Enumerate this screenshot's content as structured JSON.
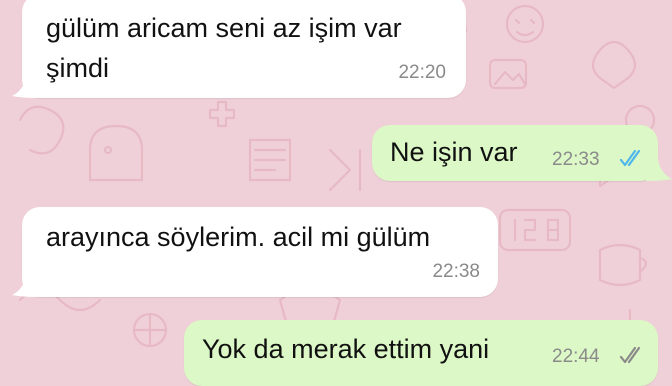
{
  "chat": {
    "wallpaper_color": "#f0d0d8",
    "incoming_bubble_color": "#ffffff",
    "outgoing_bubble_color": "#dcf8c6",
    "read_tick_color": "#4fb6ec",
    "delivered_tick_color": "#8a8a8a",
    "messages": [
      {
        "direction": "incoming",
        "text": "gülüm aricam seni az işim var\nşimdi",
        "time": "22:20"
      },
      {
        "direction": "outgoing",
        "text": "Ne işin var",
        "time": "22:33",
        "status": "read",
        "status_icon": "double-check-blue-icon"
      },
      {
        "direction": "incoming",
        "text": "arayınca söylerim. acil mi gülüm",
        "time": "22:38"
      },
      {
        "direction": "outgoing",
        "text": "Yok da merak ettim yani",
        "time": "22:44",
        "status": "delivered",
        "status_icon": "double-check-gray-icon"
      }
    ]
  }
}
